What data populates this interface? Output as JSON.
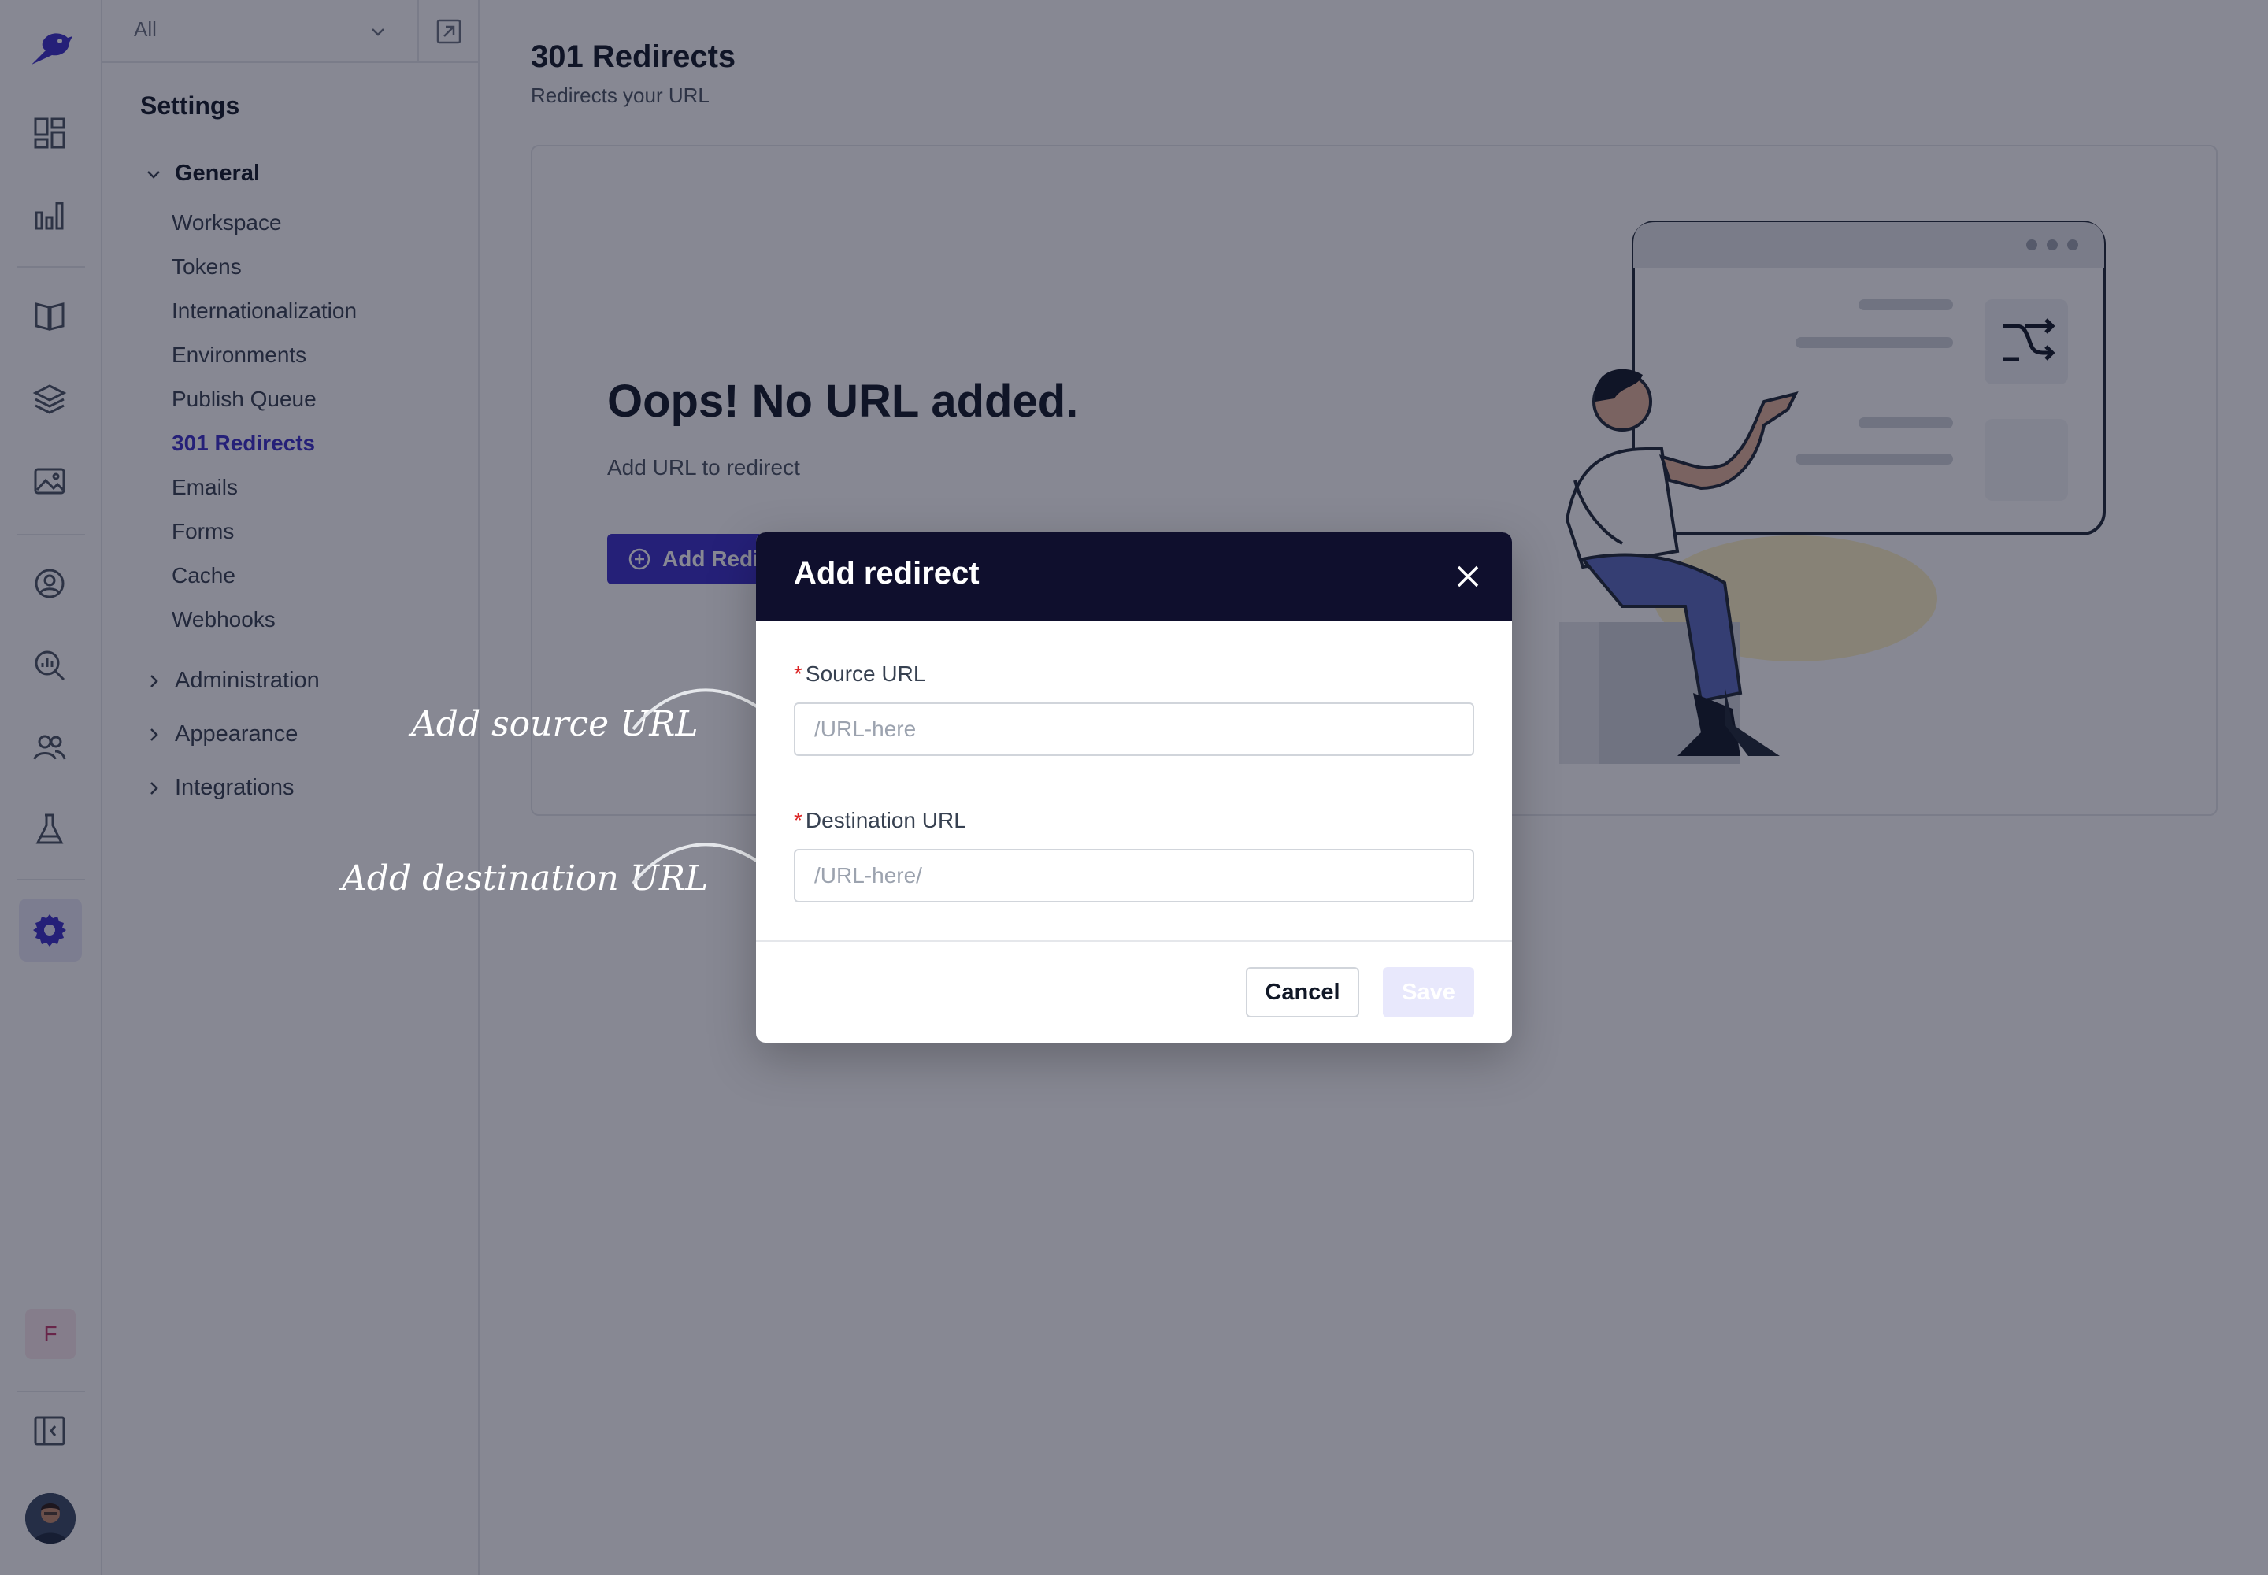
{
  "rail": {
    "logo": "bird-logo-icon",
    "icons": [
      "dashboard-icon",
      "analytics-icon",
      "content-book-icon",
      "layers-icon",
      "media-image-icon",
      "user-circle-icon",
      "search-analytics-icon",
      "team-icon",
      "lab-flask-icon",
      "settings-gear-icon"
    ],
    "active": "settings-gear-icon",
    "user_initial": "F",
    "colors": {
      "accent": "#3b2fc9",
      "active_bg": "#e8e8f8"
    }
  },
  "sidebar": {
    "select_value": "All",
    "title": "Settings",
    "general_label": "General",
    "items": [
      {
        "label": "Workspace"
      },
      {
        "label": "Tokens"
      },
      {
        "label": "Internationalization"
      },
      {
        "label": "Environments"
      },
      {
        "label": "Publish Queue"
      },
      {
        "label": "301 Redirects",
        "active": true
      },
      {
        "label": "Emails"
      },
      {
        "label": "Forms"
      },
      {
        "label": "Cache"
      },
      {
        "label": "Webhooks"
      }
    ],
    "groups": [
      {
        "label": "Administration"
      },
      {
        "label": "Appearance"
      },
      {
        "label": "Integrations"
      }
    ]
  },
  "main": {
    "title": "301 Redirects",
    "subtitle": "Redirects your URL",
    "empty_heading": "Oops! No URL added.",
    "empty_text": "Add URL to redirect",
    "add_button_label": "Add Redirect"
  },
  "hints": {
    "source": "Add source URL",
    "destination": "Add destination URL"
  },
  "modal": {
    "title": "Add redirect",
    "source_label": "Source URL",
    "source_placeholder": "/URL-here",
    "source_value": "",
    "destination_label": "Destination URL",
    "destination_placeholder": "/URL-here/",
    "destination_value": "",
    "required_marker": "*",
    "cancel_label": "Cancel",
    "save_label": "Save",
    "colors": {
      "header_bg": "#0f0f2d",
      "required": "#dc2626",
      "save_disabled": "#e8e8fc"
    }
  }
}
